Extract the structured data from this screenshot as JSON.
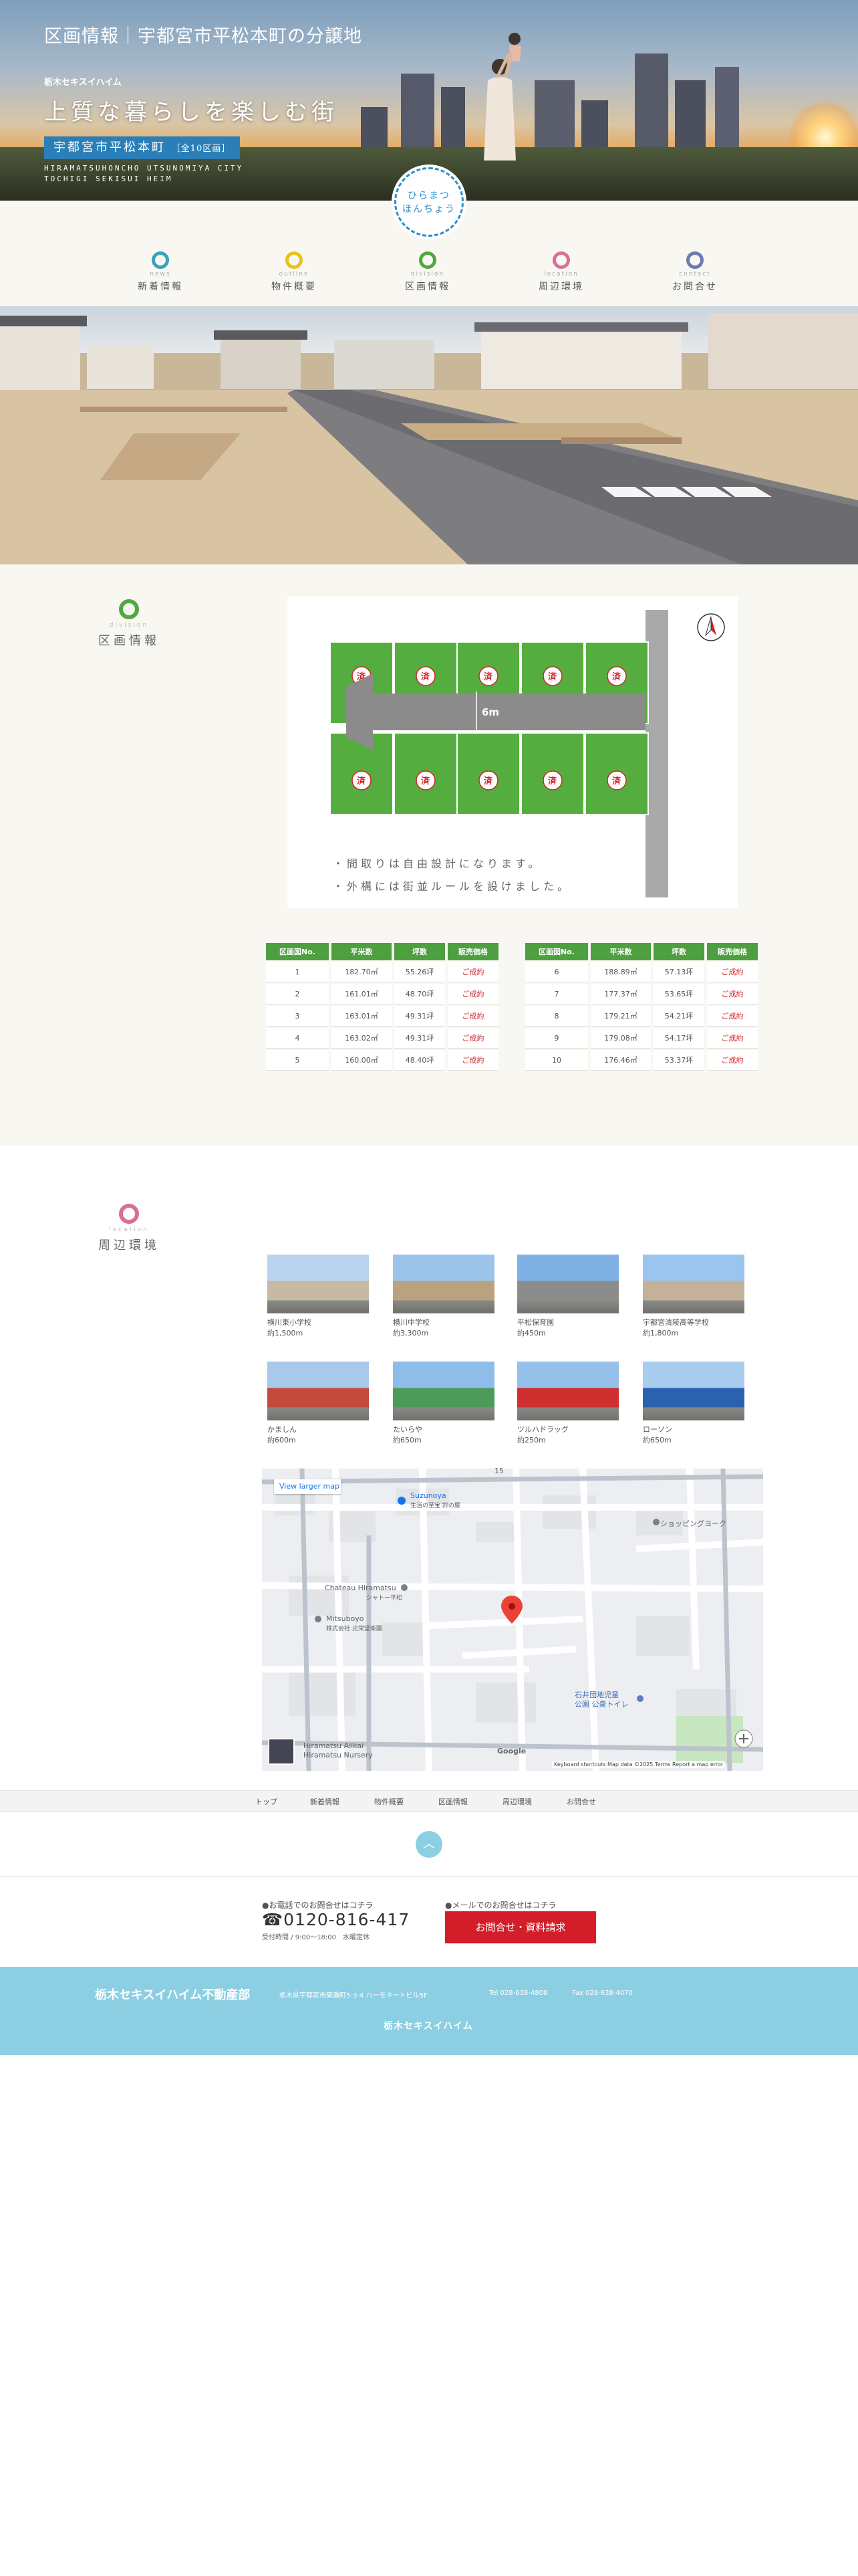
{
  "hero": {
    "title": "区画情報｜宇都宮市平松本町の分譲地",
    "brand": "栃木セキスイハイム",
    "catch": "上質な暮らしを楽しむ街",
    "badge_main": "宇都宮市平松本町",
    "badge_small": "［全10区画］",
    "roman_line1": "HIRAMATSUHONCHO UTSUNOMIYA CITY",
    "roman_line2": "TOCHIGI SEKISUI HEIM",
    "circle_line1": "ひらまつ",
    "circle_line2": "ほんちょう"
  },
  "nav": [
    {
      "en": "news",
      "jp": "新着情報",
      "color": "#3aa3b9"
    },
    {
      "en": "outline",
      "jp": "物件概要",
      "color": "#e5c419"
    },
    {
      "en": "division",
      "jp": "区画情報",
      "color": "#4fa843"
    },
    {
      "en": "location",
      "jp": "周辺環境",
      "color": "#d5709a"
    },
    {
      "en": "contact",
      "jp": "お問合せ",
      "color": "#6e7bb0"
    }
  ],
  "division": {
    "en": "division",
    "jp": "区画情報",
    "color": "#4fa843",
    "road_width": "6m",
    "sold_mark": "済",
    "notes": [
      "・間取りは自由設計になります。",
      "・外構には街並ルールを設けました。"
    ],
    "columns": [
      "区画図No.",
      "平米数",
      "坪数",
      "販売価格"
    ],
    "lots_left": [
      [
        "1",
        "182.70㎡",
        "55.26坪",
        "ご成約"
      ],
      [
        "2",
        "161.01㎡",
        "48.70坪",
        "ご成約"
      ],
      [
        "3",
        "163.01㎡",
        "49.31坪",
        "ご成約"
      ],
      [
        "4",
        "163.02㎡",
        "49.31坪",
        "ご成約"
      ],
      [
        "5",
        "160.00㎡",
        "48.40坪",
        "ご成約"
      ]
    ],
    "lots_right": [
      [
        "6",
        "188.89㎡",
        "57.13坪",
        "ご成約"
      ],
      [
        "7",
        "177.37㎡",
        "53.65坪",
        "ご成約"
      ],
      [
        "8",
        "179.21㎡",
        "54.21坪",
        "ご成約"
      ],
      [
        "9",
        "179.08㎡",
        "54.17坪",
        "ご成約"
      ],
      [
        "10",
        "176.46㎡",
        "53.37坪",
        "ご成約"
      ]
    ]
  },
  "location": {
    "en": "location",
    "jp": "周辺環境",
    "color": "#d5709a",
    "spots": [
      {
        "name": "横川東小学校",
        "dist": "約1,500m"
      },
      {
        "name": "横川中学校",
        "dist": "約3,300m"
      },
      {
        "name": "平松保育園",
        "dist": "約450m"
      },
      {
        "name": "宇都宮清陵高等学校",
        "dist": "約1,800m"
      },
      {
        "name": "かましん",
        "dist": "約600m"
      },
      {
        "name": "たいらや",
        "dist": "約650m"
      },
      {
        "name": "ツルハドラッグ",
        "dist": "約250m"
      },
      {
        "name": "ローソン",
        "dist": "約650m"
      }
    ]
  },
  "map": {
    "larger_link": "View larger map",
    "labels": {
      "suzunoya": "Suzunoya",
      "suzunoya_jp": "生活の至宝 鈴の屋",
      "court": "ショッピングヨーク",
      "chateau": "Chateau Hiramatsu",
      "chateau_jp": "シャトー平松",
      "mitsuboyo": "Mitsuboyo",
      "mitsuboyo_jp": "株式会社 光栄堂楽園",
      "park": "石井団地児童",
      "park2": "公園 公衆トイレ",
      "nursery": "Hiramatsu Aiikai",
      "nursery2": "Hiramatsu Nursery",
      "num15": "15",
      "google": "Google"
    },
    "footer": "Keyboard shortcuts   Map data ©2025   Terms   Report a map error"
  },
  "footnav": [
    "トップ",
    "新着情報",
    "物件概要",
    "区画情報",
    "周辺環境",
    "お問合せ"
  ],
  "totop": "︿",
  "contact": {
    "tel_label": "●お電話でのお問合せはコチラ",
    "tel": "☎0120-816-417",
    "hours": "受付時間 / 9:00〜18:00　水曜定休",
    "mail_label": "●メールでのお問合せはコチラ",
    "button": "お問合せ・資料請求"
  },
  "footer": {
    "name": "栃木セキスイハイム不動産部",
    "address": "栃木県宇都宮市築瀬町5-3-4 ハーモネートビル5F",
    "tel": "Tel 028-638-4808",
    "fax": "Fax 028-638-4070",
    "logo": "栃木セキスイハイム"
  }
}
